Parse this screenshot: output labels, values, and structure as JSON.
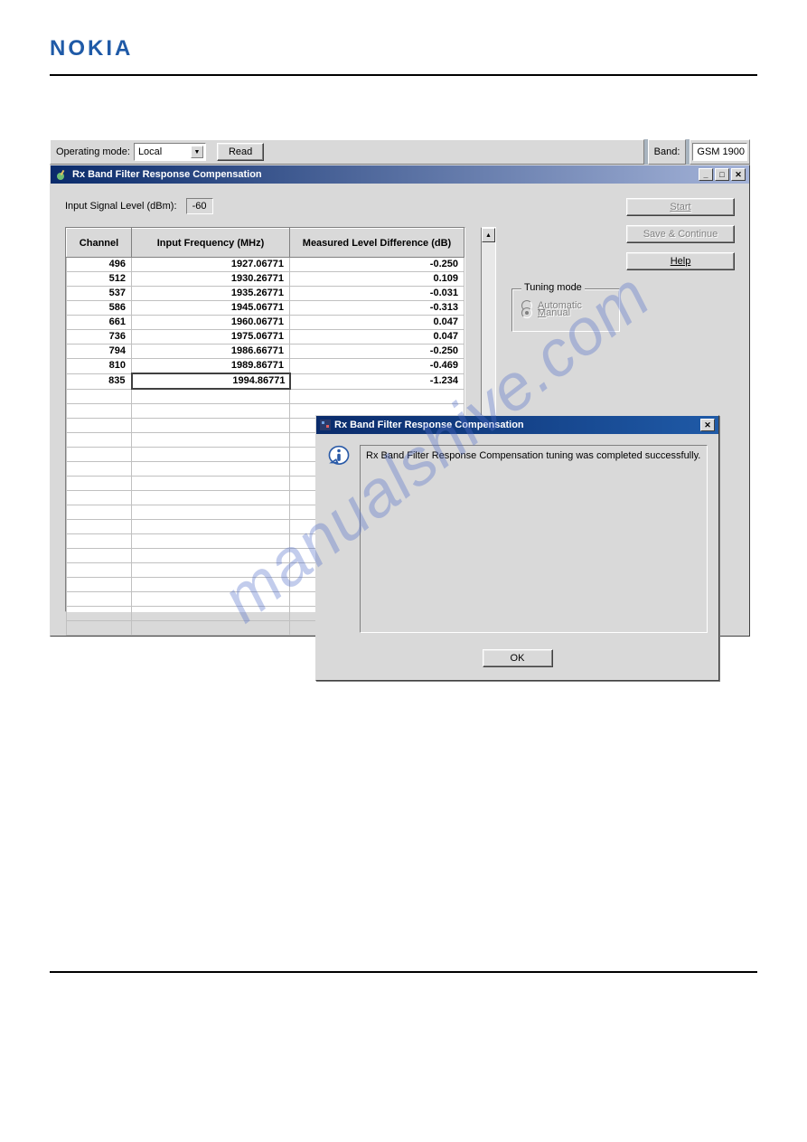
{
  "brand": "NOKIA",
  "toolbar": {
    "operating_mode_label": "Operating mode:",
    "operating_mode_value": "Local",
    "read_label": "Read",
    "band_label": "Band:",
    "band_value": "GSM 1900"
  },
  "window": {
    "title": "Rx Band Filter Response Compensation",
    "input_signal_label": "Input Signal Level (dBm):",
    "input_signal_value": "-60",
    "columns": {
      "channel": "Channel",
      "input_freq": "Input Frequency (MHz)",
      "measured": "Measured Level Difference (dB)"
    },
    "rows": [
      {
        "channel": "496",
        "freq": "1927.06771",
        "diff": "-0.250"
      },
      {
        "channel": "512",
        "freq": "1930.26771",
        "diff": "0.109"
      },
      {
        "channel": "537",
        "freq": "1935.26771",
        "diff": "-0.031"
      },
      {
        "channel": "586",
        "freq": "1945.06771",
        "diff": "-0.313"
      },
      {
        "channel": "661",
        "freq": "1960.06771",
        "diff": "0.047"
      },
      {
        "channel": "736",
        "freq": "1975.06771",
        "diff": "0.047"
      },
      {
        "channel": "794",
        "freq": "1986.66771",
        "diff": "-0.250"
      },
      {
        "channel": "810",
        "freq": "1989.86771",
        "diff": "-0.469"
      },
      {
        "channel": "835",
        "freq": "1994.86771",
        "diff": "-1.234"
      }
    ],
    "buttons": {
      "start": "Start",
      "save_continue": "Save & Continue",
      "help": "Help"
    },
    "tuning_mode": {
      "legend": "Tuning mode",
      "automatic": "Automatic",
      "manual": "Manual",
      "selected": "manual"
    }
  },
  "dialog": {
    "title": "Rx Band Filter Response Compensation",
    "message": "Rx Band Filter Response Compensation tuning was completed successfully.",
    "ok": "OK"
  },
  "watermark": "manualshive.com"
}
